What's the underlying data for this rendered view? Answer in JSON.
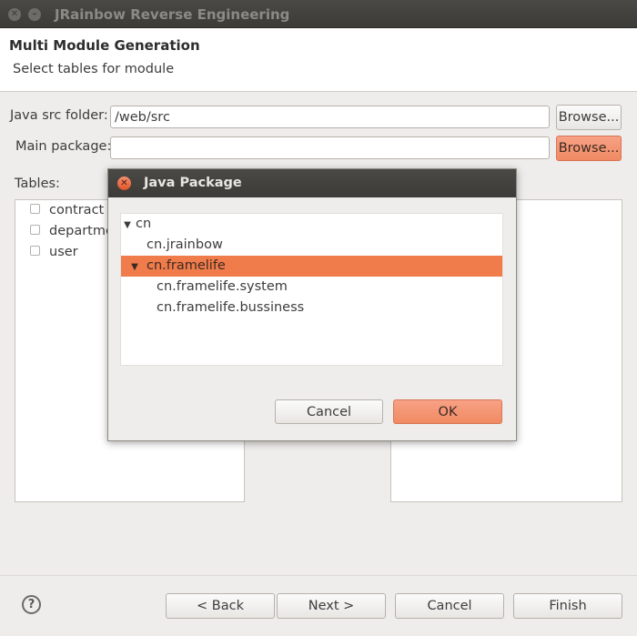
{
  "window": {
    "title": "JRainbow Reverse Engineering"
  },
  "header": {
    "title": "Multi Module Generation",
    "subtitle": "Select tables for module"
  },
  "form": {
    "src_label": "Java src folder:",
    "src_value": "/web/src",
    "pkg_label": "Main package:",
    "pkg_value": "",
    "browse_label": "Browse..."
  },
  "tables": {
    "label": "Tables:",
    "items": [
      "contract",
      "departme",
      "user"
    ]
  },
  "dialog": {
    "title": "Java Package",
    "tree": [
      {
        "label": "cn",
        "expanded": true,
        "level": 0
      },
      {
        "label": "cn.jrainbow",
        "level": 1
      },
      {
        "label": "cn.framelife",
        "expanded": true,
        "selected": true,
        "level": 1
      },
      {
        "label": "cn.framelife.system",
        "level": 2
      },
      {
        "label": "cn.framelife.bussiness",
        "level": 2
      }
    ],
    "cancel_label": "Cancel",
    "ok_label": "OK"
  },
  "footer": {
    "help_glyph": "?",
    "back_label": "< Back",
    "next_label": "Next >",
    "cancel_label": "Cancel",
    "finish_label": "Finish"
  },
  "icons": {
    "close_glyph": "✕",
    "min_glyph": "–",
    "expand_glyph": "▼"
  },
  "colors": {
    "accent": "#f07b4b",
    "titlebar": "#3c3b37"
  }
}
